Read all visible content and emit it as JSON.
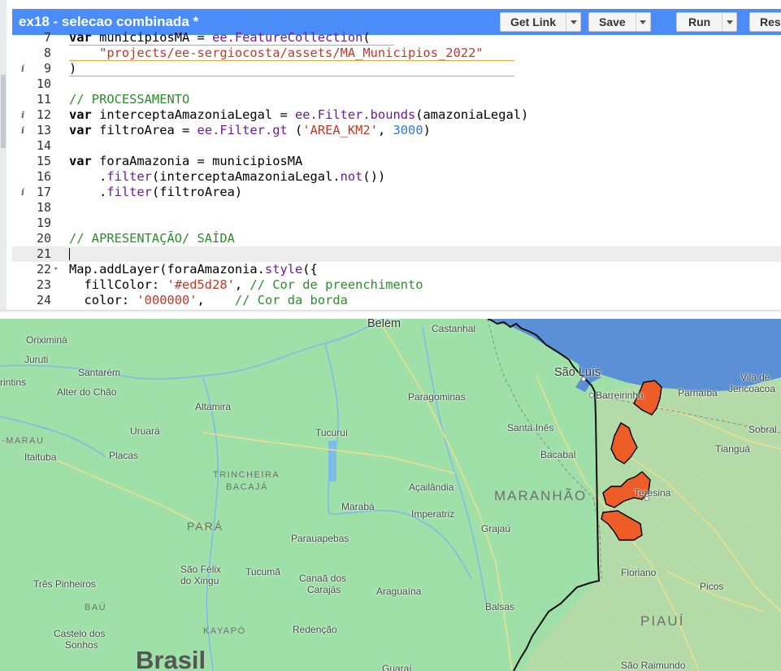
{
  "editor": {
    "title": "ex18 - selecao combinada *",
    "buttons": {
      "get_link": "Get Link",
      "save": "Save",
      "run": "Run",
      "reset": "Rese"
    },
    "lines": [
      {
        "n": "7",
        "icon": "",
        "fold": "",
        "tokens": [
          [
            "kw",
            "var"
          ],
          [
            "sym",
            " municipiosMA = "
          ],
          [
            "ee",
            "ee.FeatureCollection"
          ],
          [
            "sym",
            "("
          ]
        ]
      },
      {
        "n": "8",
        "icon": "",
        "fold": "",
        "tokens": [
          [
            "sym",
            "    "
          ],
          [
            "str",
            "\"projects/ee-sergiocosta/assets/MA_Municipios_2022\""
          ]
        ]
      },
      {
        "n": "9",
        "icon": "i",
        "fold": "",
        "tokens": [
          [
            "sym",
            ")"
          ]
        ]
      },
      {
        "n": "10",
        "icon": "",
        "fold": "",
        "tokens": []
      },
      {
        "n": "11",
        "icon": "",
        "fold": "",
        "tokens": [
          [
            "cmt",
            "// PROCESSAMENTO"
          ]
        ]
      },
      {
        "n": "12",
        "icon": "i",
        "fold": "",
        "tokens": [
          [
            "kw",
            "var"
          ],
          [
            "sym",
            " interceptaAmazoniaLegal = "
          ],
          [
            "ee",
            "ee.Filter.bounds"
          ],
          [
            "sym",
            "(amazoniaLegal)"
          ]
        ]
      },
      {
        "n": "13",
        "icon": "i",
        "fold": "",
        "tokens": [
          [
            "kw",
            "var"
          ],
          [
            "sym",
            " filtroArea = "
          ],
          [
            "ee",
            "ee.Filter.gt"
          ],
          [
            "sym",
            " ("
          ],
          [
            "str",
            "'AREA_KM2'"
          ],
          [
            "sym",
            ", "
          ],
          [
            "num",
            "3000"
          ],
          [
            "sym",
            ")"
          ]
        ]
      },
      {
        "n": "14",
        "icon": "",
        "fold": "",
        "tokens": []
      },
      {
        "n": "15",
        "icon": "",
        "fold": "",
        "tokens": [
          [
            "kw",
            "var"
          ],
          [
            "sym",
            " foraAmazonia = municipiosMA"
          ]
        ]
      },
      {
        "n": "16",
        "icon": "",
        "fold": "",
        "tokens": [
          [
            "sym",
            "    ."
          ],
          [
            "meth",
            "filter"
          ],
          [
            "sym",
            "(interceptaAmazoniaLegal."
          ],
          [
            "meth",
            "not"
          ],
          [
            "sym",
            "())"
          ]
        ]
      },
      {
        "n": "17",
        "icon": "i",
        "fold": "",
        "tokens": [
          [
            "sym",
            "    ."
          ],
          [
            "meth",
            "filter"
          ],
          [
            "sym",
            "(filtroArea)"
          ]
        ]
      },
      {
        "n": "18",
        "icon": "",
        "fold": "",
        "tokens": []
      },
      {
        "n": "19",
        "icon": "",
        "fold": "",
        "tokens": []
      },
      {
        "n": "20",
        "icon": "",
        "fold": "",
        "tokens": [
          [
            "cmt",
            "// APRESENTAÇÃO/ SAÍDA"
          ]
        ]
      },
      {
        "n": "21",
        "icon": "",
        "fold": "",
        "tokens": []
      },
      {
        "n": "22",
        "icon": "",
        "fold": "▾",
        "tokens": [
          [
            "sym",
            "Map.addLayer(foraAmazonia."
          ],
          [
            "meth",
            "style"
          ],
          [
            "sym",
            "({"
          ]
        ]
      },
      {
        "n": "23",
        "icon": "",
        "fold": "",
        "tokens": [
          [
            "sym",
            "  fillColor: "
          ],
          [
            "str",
            "'#ed5d28'"
          ],
          [
            "sym",
            ", "
          ],
          [
            "cmt",
            "// Cor de preenchimento"
          ]
        ]
      },
      {
        "n": "24",
        "icon": "",
        "fold": "",
        "tokens": [
          [
            "sym",
            "  color: "
          ],
          [
            "str",
            "'000000'"
          ],
          [
            "sym",
            ",    "
          ],
          [
            "cmt",
            "// Cor da borda"
          ]
        ]
      }
    ]
  },
  "map": {
    "colors": {
      "land": "#9fe0a8",
      "ocean": "#5b8fd6",
      "highlight_fill": "#ed5d28",
      "highlight_border": "#000000",
      "rivers": "#7dbbe8",
      "roads": "#f2e08a"
    },
    "places": {
      "belem": "Belém",
      "castanhal": "Castanhal",
      "oriximina": "Oriximiná",
      "juruti": "Juruti",
      "santarem": "Santarém",
      "rintins": "rintins",
      "alter_do_chao": "Alter do Chão",
      "altamira": "Altamira",
      "paragominas": "Paragominas",
      "sao_luis": "São Luís",
      "barreirinhas": "Barreirinha",
      "parnaiba": "Parnaíba",
      "vila_de": "Vila de",
      "jericoacoara": "Jericoacoa",
      "santa_ines": "Santa Inês",
      "sobral": "Sobral",
      "tiangua": "Tianguá",
      "uruara": "Uruará",
      "tucurui": "Tucuruí",
      "itaituba": "Itaituba",
      "placas": "Placas",
      "bacabal": "Bacabal",
      "acailandia": "Açailândia",
      "teresina": "Teresina",
      "maraba": "Marabá",
      "imperatriz": "Imperatriz",
      "grajau": "Grajaú",
      "parauapebas": "Parauapebas",
      "sao_felix_1": "São Félix",
      "sao_felix_2": "do Xingu",
      "tucuma": "Tucumã",
      "canaa_1": "Canaã dos",
      "canaa_2": "Carajás",
      "floriano": "Floriano",
      "tres_pinheiros": "Três Pinheiros",
      "araguaina": "Araguaína",
      "picos": "Picos",
      "balsas": "Balsas",
      "castelo_1": "Castelo dos",
      "castelo_2": "Sonhos",
      "redencao": "Redenção",
      "sao_raimundo": "São Raimundo",
      "guarai": "Guaraí"
    },
    "regions": {
      "marau": "-MARAU",
      "trincheira_1": "TRINCHEIRA",
      "trincheira_2": "BACAJÁ",
      "para": "PARÁ",
      "maranhao": "MARANHÃO",
      "bau": "BAÚ",
      "kayapo": "KAYAPÓ",
      "piaui": "PIAUÍ"
    },
    "country": "Brasil"
  }
}
